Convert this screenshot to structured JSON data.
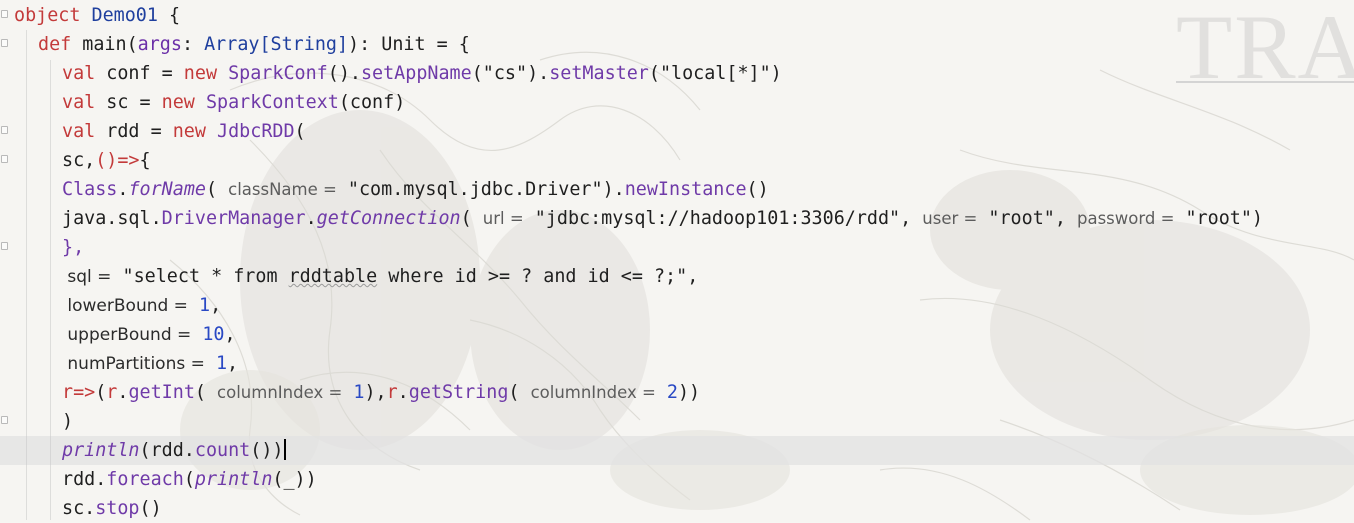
{
  "watermark_text": "TRA",
  "editor": {
    "language": "Scala",
    "current_line": 16,
    "lines": [
      {
        "tokens": [
          [
            "kw",
            "object"
          ],
          [
            "plain",
            " "
          ],
          [
            "ty",
            "Demo01"
          ],
          [
            "plain",
            " {"
          ]
        ]
      },
      {
        "tokens": [
          [
            "kw",
            "def"
          ],
          [
            "plain",
            " main("
          ],
          [
            "par",
            "args"
          ],
          [
            "plain",
            ": "
          ],
          [
            "ty",
            "Array[String]"
          ],
          [
            "plain",
            "): Unit = {"
          ]
        ]
      },
      {
        "tokens": [
          [
            "kw",
            "val"
          ],
          [
            "plain",
            " conf = "
          ],
          [
            "kw",
            "new"
          ],
          [
            "plain",
            " "
          ],
          [
            "fn",
            "SparkConf"
          ],
          [
            "plain",
            "()."
          ],
          [
            "fn",
            "setAppName"
          ],
          [
            "plain",
            "(\"cs\")."
          ],
          [
            "fn",
            "setMaster"
          ],
          [
            "plain",
            "(\"local[*]\")"
          ]
        ]
      },
      {
        "tokens": [
          [
            "kw",
            "val"
          ],
          [
            "plain",
            " sc = "
          ],
          [
            "kw",
            "new"
          ],
          [
            "plain",
            " "
          ],
          [
            "fn",
            "SparkContext"
          ],
          [
            "plain",
            "(conf)"
          ]
        ]
      },
      {
        "tokens": [
          [
            "kw",
            "val"
          ],
          [
            "plain",
            " rdd = "
          ],
          [
            "kw",
            "new"
          ],
          [
            "plain",
            " "
          ],
          [
            "fn",
            "JdbcRDD"
          ],
          [
            "plain",
            "("
          ]
        ]
      },
      {
        "tokens": [
          [
            "plain",
            "sc,"
          ],
          [
            "kw",
            "()=>"
          ],
          [
            "plain",
            "{"
          ]
        ]
      },
      {
        "tokens": [
          [
            "fn",
            "Class"
          ],
          [
            "plain",
            "."
          ],
          [
            "it",
            "forName"
          ],
          [
            "plain",
            "( "
          ],
          [
            "hint",
            "className ="
          ],
          [
            "plain",
            " \"com.mysql.jdbc.Driver\")."
          ],
          [
            "fn",
            "newInstance"
          ],
          [
            "plain",
            "()"
          ]
        ]
      },
      {
        "tokens": [
          [
            "plain",
            "java.sql."
          ],
          [
            "fn",
            "DriverManager"
          ],
          [
            "plain",
            "."
          ],
          [
            "it",
            "getConnection"
          ],
          [
            "plain",
            "( "
          ],
          [
            "hint",
            "url ="
          ],
          [
            "plain",
            " \"jdbc:mysql://hadoop101:3306/rdd\", "
          ],
          [
            "hint",
            "user ="
          ],
          [
            "plain",
            " \"root\", "
          ],
          [
            "hint",
            "password ="
          ],
          [
            "plain",
            " \"root\")"
          ]
        ]
      },
      {
        "tokens": [
          [
            "fn",
            "},"
          ]
        ]
      },
      {
        "tokens": [
          [
            "named",
            " sql ="
          ],
          [
            "plain",
            " \"select * from "
          ],
          [
            "squig",
            "rddtable"
          ],
          [
            "plain",
            " where id >= ? and id <= ?;\","
          ]
        ]
      },
      {
        "tokens": [
          [
            "named",
            " lowerBound ="
          ],
          [
            "plain",
            " "
          ],
          [
            "num",
            "1"
          ],
          [
            "plain",
            ","
          ]
        ]
      },
      {
        "tokens": [
          [
            "named",
            " upperBound ="
          ],
          [
            "plain",
            " "
          ],
          [
            "num",
            "10"
          ],
          [
            "plain",
            ","
          ]
        ]
      },
      {
        "tokens": [
          [
            "named",
            " numPartitions ="
          ],
          [
            "plain",
            " "
          ],
          [
            "num",
            "1"
          ],
          [
            "plain",
            ","
          ]
        ]
      },
      {
        "tokens": [
          [
            "kw",
            "r=>"
          ],
          [
            "plain",
            "("
          ],
          [
            "kw",
            "r"
          ],
          [
            "plain",
            "."
          ],
          [
            "fn",
            "getInt"
          ],
          [
            "plain",
            "( "
          ],
          [
            "hint",
            "columnIndex ="
          ],
          [
            "plain",
            " "
          ],
          [
            "num",
            "1"
          ],
          [
            "plain",
            "),"
          ],
          [
            "kw",
            "r"
          ],
          [
            "plain",
            "."
          ],
          [
            "fn",
            "getString"
          ],
          [
            "plain",
            "( "
          ],
          [
            "hint",
            "columnIndex ="
          ],
          [
            "plain",
            " "
          ],
          [
            "num",
            "2"
          ],
          [
            "plain",
            "))"
          ]
        ]
      },
      {
        "tokens": [
          [
            "plain",
            ")"
          ]
        ]
      },
      {
        "tokens": [
          [
            "it",
            "println"
          ],
          [
            "plain",
            "(rdd."
          ],
          [
            "fn",
            "count"
          ],
          [
            "plain",
            "())"
          ]
        ]
      },
      {
        "tokens": [
          [
            "plain",
            "rdd."
          ],
          [
            "fn",
            "foreach"
          ],
          [
            "plain",
            "("
          ],
          [
            "it",
            "println"
          ],
          [
            "plain",
            "(_))"
          ]
        ]
      },
      {
        "tokens": [
          [
            "plain",
            "sc."
          ],
          [
            "fn",
            "stop"
          ],
          [
            "plain",
            "()"
          ]
        ]
      }
    ]
  }
}
